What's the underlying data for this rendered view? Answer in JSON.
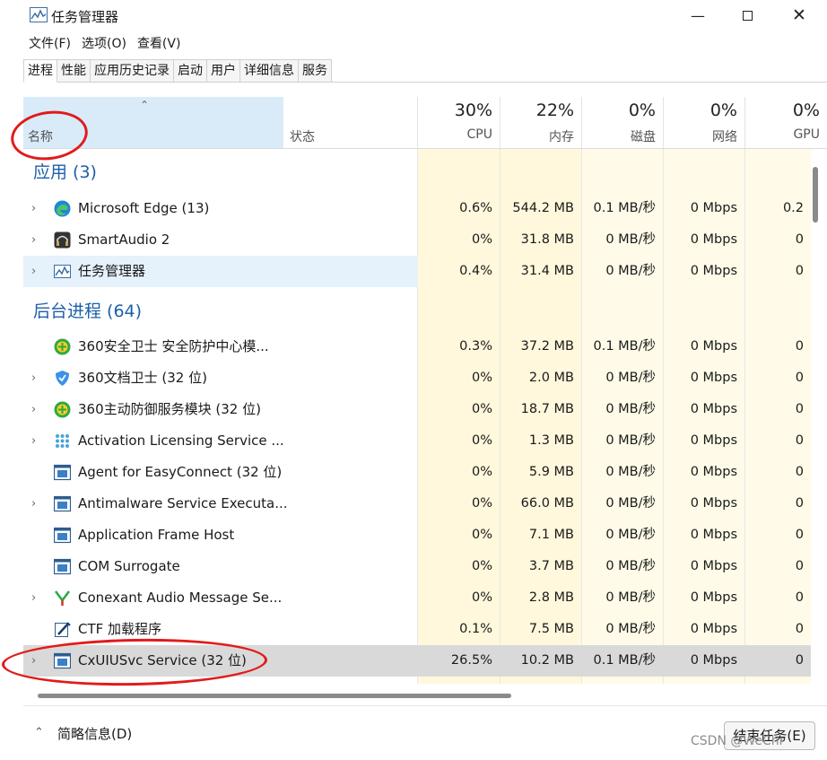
{
  "window": {
    "title": "任务管理器"
  },
  "menu": [
    "文件(F)",
    "选项(O)",
    "查看(V)"
  ],
  "tabs": [
    "进程",
    "性能",
    "应用历史记录",
    "启动",
    "用户",
    "详细信息",
    "服务"
  ],
  "header": {
    "name": "名称",
    "status": "状态",
    "columns": [
      {
        "pct": "30%",
        "label": "CPU"
      },
      {
        "pct": "22%",
        "label": "内存"
      },
      {
        "pct": "0%",
        "label": "磁盘"
      },
      {
        "pct": "0%",
        "label": "网络"
      },
      {
        "pct": "0%",
        "label": "GPU"
      }
    ]
  },
  "groups": {
    "apps": "应用 (3)",
    "background": "后台进程 (64)"
  },
  "rows": [
    {
      "name": "Microsoft Edge (13)",
      "icon": "edge-icon",
      "chev": true,
      "cpu": "0.6%",
      "mem": "544.2 MB",
      "disk": "0.1 MB/秒",
      "net": "0 Mbps",
      "gpu": "0.2"
    },
    {
      "name": "SmartAudio 2",
      "icon": "smartaudio-icon",
      "chev": true,
      "cpu": "0%",
      "mem": "31.8 MB",
      "disk": "0 MB/秒",
      "net": "0 Mbps",
      "gpu": "0"
    },
    {
      "name": "任务管理器",
      "icon": "task-manager-icon",
      "chev": true,
      "cpu": "0.4%",
      "mem": "31.4 MB",
      "disk": "0 MB/秒",
      "net": "0 Mbps",
      "gpu": "0"
    },
    {
      "name": "360安全卫士 安全防护中心模...",
      "icon": "360-security-icon",
      "chev": false,
      "cpu": "0.3%",
      "mem": "37.2 MB",
      "disk": "0.1 MB/秒",
      "net": "0 Mbps",
      "gpu": "0"
    },
    {
      "name": "360文档卫士 (32 位)",
      "icon": "shield-icon",
      "chev": true,
      "cpu": "0%",
      "mem": "2.0 MB",
      "disk": "0 MB/秒",
      "net": "0 Mbps",
      "gpu": "0"
    },
    {
      "name": "360主动防御服务模块 (32 位)",
      "icon": "360-security-icon",
      "chev": true,
      "cpu": "0%",
      "mem": "18.7 MB",
      "disk": "0 MB/秒",
      "net": "0 Mbps",
      "gpu": "0"
    },
    {
      "name": "Activation Licensing Service ...",
      "icon": "dots-icon",
      "chev": true,
      "cpu": "0%",
      "mem": "1.3 MB",
      "disk": "0 MB/秒",
      "net": "0 Mbps",
      "gpu": "0"
    },
    {
      "name": "Agent for EasyConnect (32 位)",
      "icon": "window-icon",
      "chev": false,
      "cpu": "0%",
      "mem": "5.9 MB",
      "disk": "0 MB/秒",
      "net": "0 Mbps",
      "gpu": "0"
    },
    {
      "name": "Antimalware Service Executa...",
      "icon": "window-icon",
      "chev": true,
      "cpu": "0%",
      "mem": "66.0 MB",
      "disk": "0 MB/秒",
      "net": "0 Mbps",
      "gpu": "0"
    },
    {
      "name": "Application Frame Host",
      "icon": "window-icon",
      "chev": false,
      "cpu": "0%",
      "mem": "7.1 MB",
      "disk": "0 MB/秒",
      "net": "0 Mbps",
      "gpu": "0"
    },
    {
      "name": "COM Surrogate",
      "icon": "window-icon",
      "chev": false,
      "cpu": "0%",
      "mem": "3.7 MB",
      "disk": "0 MB/秒",
      "net": "0 Mbps",
      "gpu": "0"
    },
    {
      "name": "Conexant Audio Message Se...",
      "icon": "conexant-icon",
      "chev": true,
      "cpu": "0%",
      "mem": "2.8 MB",
      "disk": "0 MB/秒",
      "net": "0 Mbps",
      "gpu": "0"
    },
    {
      "name": "CTF 加载程序",
      "icon": "ctf-icon",
      "chev": false,
      "cpu": "0.1%",
      "mem": "7.5 MB",
      "disk": "0 MB/秒",
      "net": "0 Mbps",
      "gpu": "0"
    },
    {
      "name": "CxUIUSvc Service (32 位)",
      "icon": "window-icon",
      "chev": true,
      "cpu": "26.5%",
      "mem": "10.2 MB",
      "disk": "0.1 MB/秒",
      "net": "0 Mbps",
      "gpu": "0"
    }
  ],
  "footer": {
    "summary": "简略信息(D)",
    "end_task": "结束任务(E)"
  },
  "watermark": "CSDN @WeChr"
}
